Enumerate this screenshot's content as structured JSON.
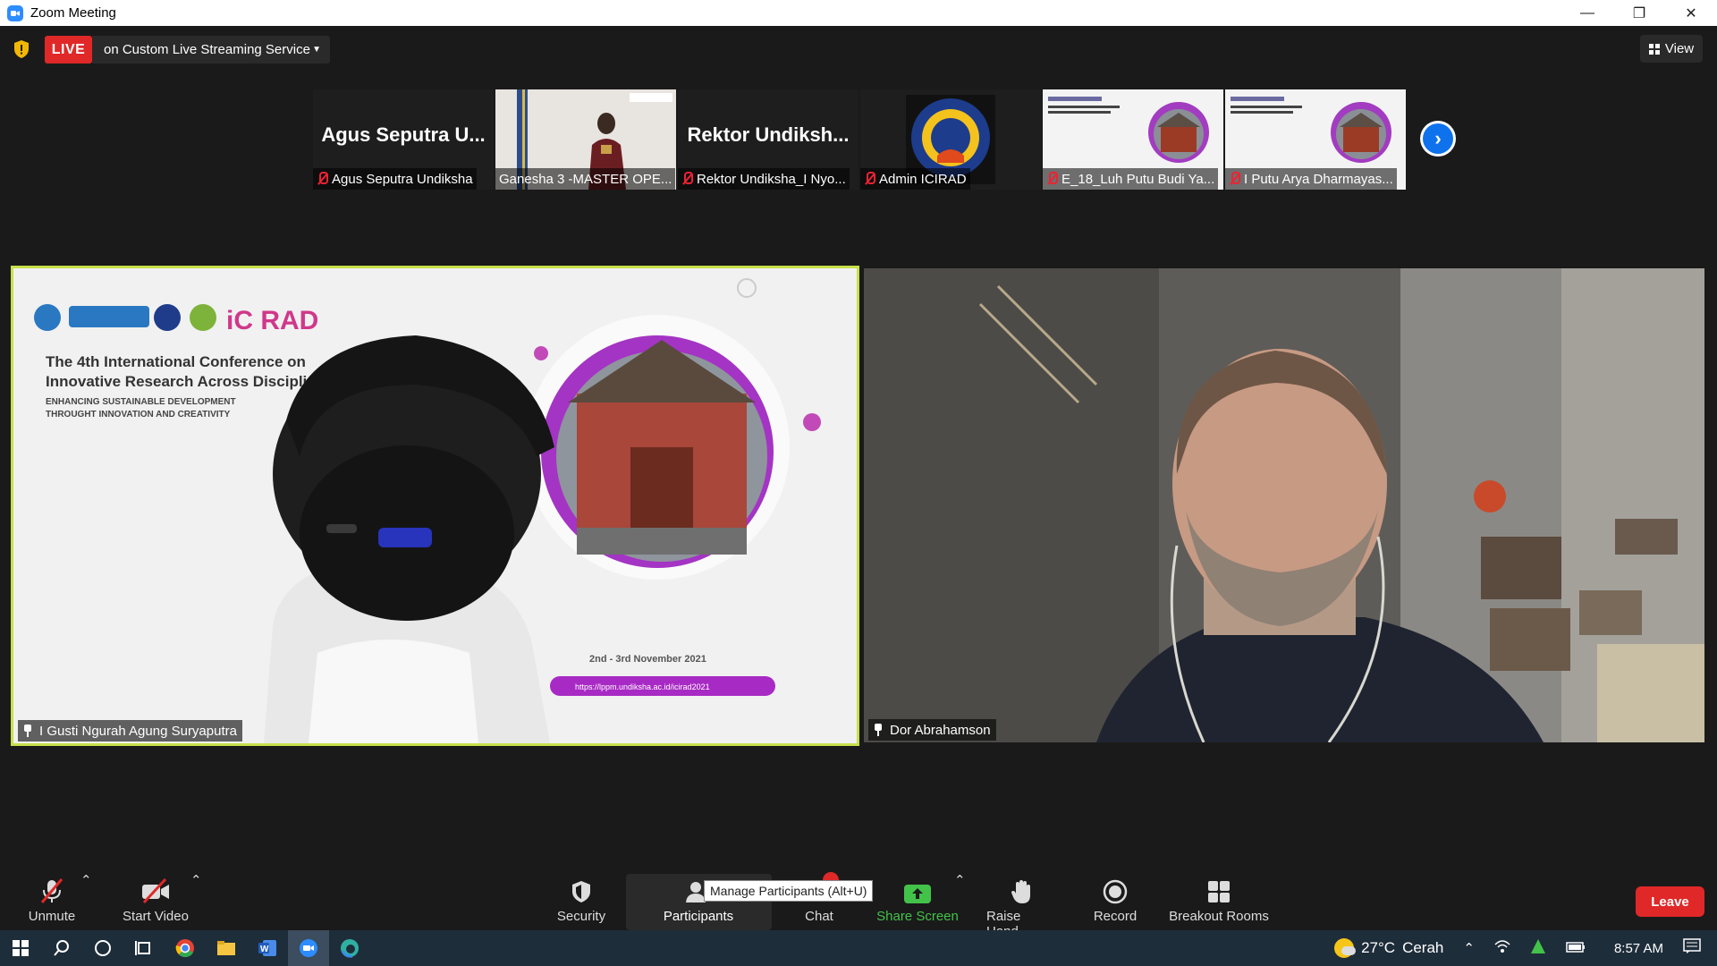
{
  "window": {
    "title": "Zoom Meeting",
    "minimize": "—",
    "restore": "❐",
    "close": "✕"
  },
  "live": {
    "badge": "LIVE",
    "service": "on Custom Live Streaming Service"
  },
  "view_button": {
    "label": "View"
  },
  "thumbnails": [
    {
      "display_text": "Agus Seputra U...",
      "name": "Agus Seputra Undiksha",
      "muted": true,
      "kind": "text"
    },
    {
      "display_text": "",
      "name": "Ganesha 3 -MASTER OPE...",
      "muted": false,
      "kind": "video"
    },
    {
      "display_text": "Rektor Undiksh...",
      "name": "Rektor Undiksha_I Nyo...",
      "muted": true,
      "kind": "text"
    },
    {
      "display_text": "",
      "name": "Admin ICIRAD",
      "muted": true,
      "kind": "logo"
    },
    {
      "display_text": "",
      "name": "E_18_Luh Putu Budi Ya...",
      "muted": true,
      "kind": "slide"
    },
    {
      "display_text": "",
      "name": "I Putu Arya Dharmayas...",
      "muted": true,
      "kind": "slide"
    }
  ],
  "videos": [
    {
      "name": "I Gusti Ngurah Agung Suryaputra",
      "slide": {
        "logo_text": "iC RAD",
        "heading_1": "The 4th International Conference on",
        "heading_2": "Innovative Research Across Discipli",
        "sub_1": "ENHANCING SUSTAINABLE DEVELOPMENT",
        "sub_2": "THROUGHT INNOVATION AND CREATIVITY",
        "date": "2nd - 3rd November 2021",
        "url": "https://lppm.undiksha.ac.id/icirad2021"
      }
    },
    {
      "name": "Dor Abrahamson"
    }
  ],
  "toolbar": {
    "unmute": "Unmute",
    "start_video": "Start Video",
    "security": "Security",
    "participants": "Participants",
    "chat": "Chat",
    "share_screen": "Share Screen",
    "raise_hand": "Raise Hand",
    "record": "Record",
    "breakout_rooms": "Breakout Rooms",
    "leave": "Leave",
    "tooltip": "Manage Participants (Alt+U)"
  },
  "taskbar": {
    "weather_temp": "27°C",
    "weather_text": "Cerah",
    "time": "8:57 AM"
  },
  "colors": {
    "live_red": "#e02828",
    "active_speaker": "#c8e04a",
    "share_green": "#43c24a",
    "zoom_blue": "#2d8cff"
  }
}
